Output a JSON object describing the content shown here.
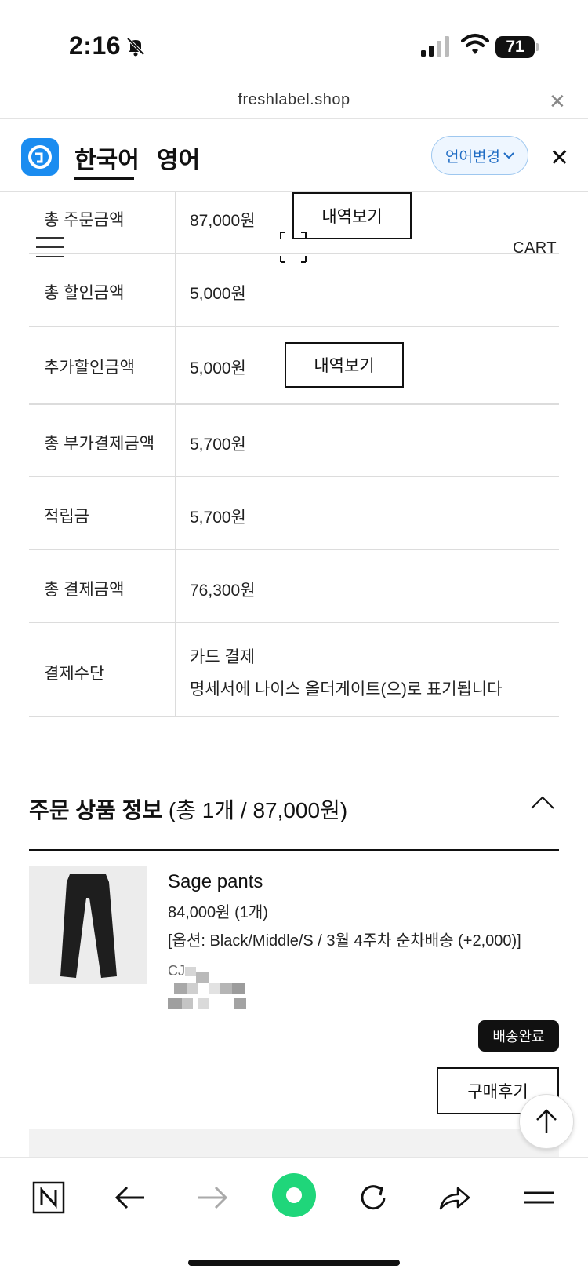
{
  "status_bar": {
    "time": "2:16",
    "battery": "71"
  },
  "browser": {
    "url": "freshlabel.shop"
  },
  "translate_bar": {
    "lang_source": "한국어",
    "lang_target": "영어",
    "change_label": "언어변경"
  },
  "header": {
    "cart_label": "CART"
  },
  "payment_table": {
    "rows": [
      {
        "label": "총 주문금액",
        "value": "87,000원",
        "button": "내역보기"
      },
      {
        "label": "총 할인금액",
        "value": "5,000원"
      },
      {
        "label": "추가할인금액",
        "value": "5,000원",
        "button": "내역보기"
      },
      {
        "label": "총 부가결제금액",
        "value": "5,700원"
      },
      {
        "label": "적립금",
        "value": "5,700원"
      },
      {
        "label": "총 결제금액",
        "value": "76,300원"
      },
      {
        "label": "결제수단",
        "value": "카드 결제",
        "value2": "명세서에 나이스 올더게이트(으)로 표기됩니다"
      }
    ]
  },
  "order_products": {
    "title_bold": "주문 상품 정보",
    "title_summary": "(총 1개 / 87,000원)",
    "items": [
      {
        "name": "Sage pants",
        "price": "84,000원 (1개)",
        "option": "[옵션: Black/Middle/S / 3월 4주차 순차배송 (+2,000)]",
        "carrier": "CJ",
        "status": "배송완료",
        "review_label": "구매후기"
      }
    ]
  },
  "colors": {
    "accent_blue": "#1a8cf0",
    "pay_button_green": "#1fd67a",
    "text": "#111111"
  }
}
